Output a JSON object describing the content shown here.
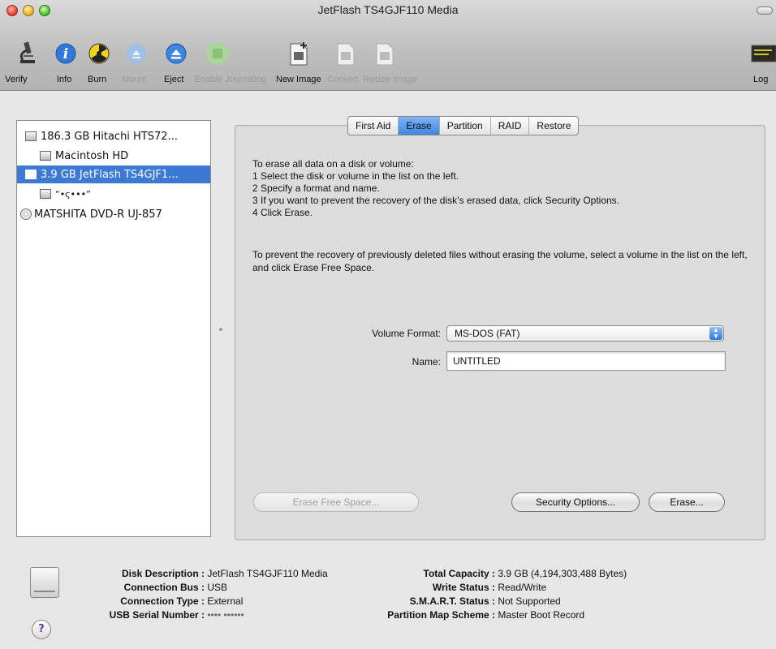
{
  "window": {
    "title": "JetFlash TS4GJF110 Media"
  },
  "toolbar": {
    "items": [
      {
        "label": "Verify",
        "icon": "microscope-icon",
        "enabled": true
      },
      {
        "label": "Info",
        "icon": "info-icon",
        "enabled": true
      },
      {
        "label": "Burn",
        "icon": "burn-icon",
        "enabled": true
      },
      {
        "label": "Mount",
        "icon": "mount-icon",
        "enabled": false
      },
      {
        "label": "Eject",
        "icon": "eject-icon",
        "enabled": true
      },
      {
        "label": "Enable Journaling",
        "icon": "journaling-icon",
        "enabled": false
      },
      {
        "label": "New Image",
        "icon": "new-image-icon",
        "enabled": true
      },
      {
        "label": "Convert",
        "icon": "convert-icon",
        "enabled": false
      },
      {
        "label": "Resize Image",
        "icon": "resize-image-icon",
        "enabled": false
      },
      {
        "label": "Log",
        "icon": "log-icon",
        "enabled": true
      }
    ]
  },
  "sidebar": {
    "items": [
      {
        "label": "186.3 GB Hitachi HTS72...",
        "selected": false
      },
      {
        "label": "Macintosh HD",
        "selected": false
      },
      {
        "label": "3.9 GB JetFlash TS4GJF1...",
        "selected": true
      },
      {
        "label": "“•ς•••”",
        "selected": false
      },
      {
        "label": "MATSHITA DVD-R UJ-857",
        "selected": false
      }
    ]
  },
  "tabs": [
    "First Aid",
    "Erase",
    "Partition",
    "RAID",
    "Restore"
  ],
  "active_tab": "Erase",
  "erase": {
    "instructions": [
      "To erase all data on a disk or volume:",
      "1  Select the disk or volume in the list on the left.",
      "2  Specify a format and name.",
      "3  If you want to prevent the recovery of the disk’s erased data, click Security Options.",
      "4  Click Erase."
    ],
    "prevent_text": "To prevent the recovery of previously deleted files without erasing the volume, select a volume in the list on the left, and click Erase Free Space.",
    "volume_format_label": "Volume Format:",
    "volume_format_value": "MS-DOS (FAT)",
    "name_label": "Name:",
    "name_value": "UNTITLED",
    "erase_free_space_button": "Erase Free Space...",
    "security_options_button": "Security Options...",
    "erase_button": "Erase..."
  },
  "info": {
    "disk_description_label": "Disk Description :",
    "disk_description": "JetFlash TS4GJF110 Media",
    "connection_bus_label": "Connection Bus :",
    "connection_bus": "USB",
    "connection_type_label": "Connection Type :",
    "connection_type": "External",
    "usb_serial_label": "USB Serial Number :",
    "usb_serial": "•••• ••••••",
    "total_capacity_label": "Total Capacity :",
    "total_capacity": "3.9 GB (4,194,303,488 Bytes)",
    "write_status_label": "Write Status :",
    "write_status": "Read/Write",
    "smart_status_label": "S.M.A.R.T. Status :",
    "smart_status": "Not Supported",
    "partition_scheme_label": "Partition Map Scheme :",
    "partition_scheme": "Master Boot Record",
    "help_glyph": "?"
  },
  "colors": {
    "selection": "#3b79d4",
    "active_tab": "#3f86e3"
  }
}
